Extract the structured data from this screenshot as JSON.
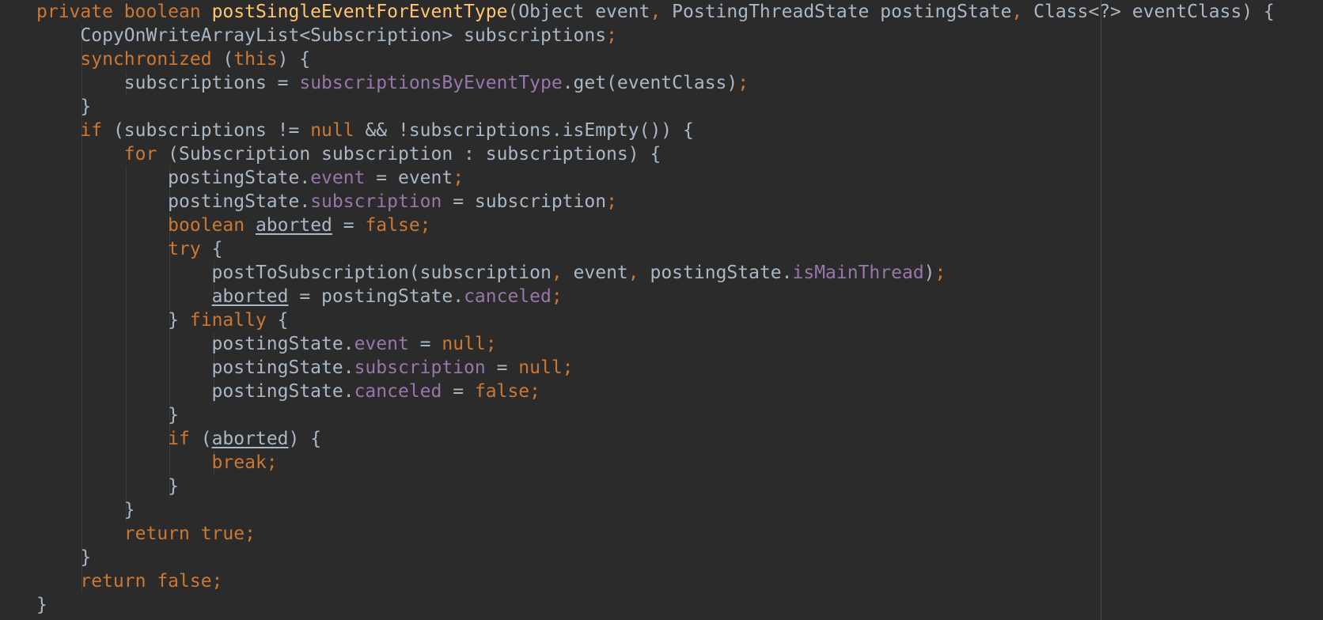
{
  "editor": {
    "theme": "darcula",
    "colors": {
      "background": "#2b2b2b",
      "text": "#a9b7c6",
      "keyword": "#cc7832",
      "function": "#ffc66d",
      "field": "#9876aa"
    },
    "lines": [
      [
        {
          "t": "private boolean ",
          "c": "kw"
        },
        {
          "t": "postSingleEventForEventType",
          "c": "fn"
        },
        {
          "t": "(Object event",
          "c": "pl"
        },
        {
          "t": ", ",
          "c": "kw"
        },
        {
          "t": "PostingThreadState postingState",
          "c": "pl"
        },
        {
          "t": ", ",
          "c": "kw"
        },
        {
          "t": "Class<?> eventClass) {",
          "c": "pl"
        }
      ],
      [
        {
          "t": "    CopyOnWriteArrayList<Subscription> subscriptions",
          "c": "pl"
        },
        {
          "t": ";",
          "c": "kw"
        }
      ],
      [
        {
          "t": "    synchronized ",
          "c": "kw"
        },
        {
          "t": "(",
          "c": "pl"
        },
        {
          "t": "this",
          "c": "kw"
        },
        {
          "t": ") {",
          "c": "pl"
        }
      ],
      [
        {
          "t": "        subscriptions = ",
          "c": "pl"
        },
        {
          "t": "subscriptionsByEventType",
          "c": "fld"
        },
        {
          "t": ".get(eventClass)",
          "c": "pl"
        },
        {
          "t": ";",
          "c": "kw"
        }
      ],
      [
        {
          "t": "    }",
          "c": "pl"
        }
      ],
      [
        {
          "t": "    if ",
          "c": "kw"
        },
        {
          "t": "(subscriptions != ",
          "c": "pl"
        },
        {
          "t": "null ",
          "c": "kw"
        },
        {
          "t": "&& !subscriptions.isEmpty()) {",
          "c": "pl"
        }
      ],
      [
        {
          "t": "        for ",
          "c": "kw"
        },
        {
          "t": "(Subscription subscription : subscriptions) {",
          "c": "pl"
        }
      ],
      [
        {
          "t": "            postingState.",
          "c": "pl"
        },
        {
          "t": "event",
          "c": "fld"
        },
        {
          "t": " = event",
          "c": "pl"
        },
        {
          "t": ";",
          "c": "kw"
        }
      ],
      [
        {
          "t": "            postingState.",
          "c": "pl"
        },
        {
          "t": "subscription",
          "c": "fld"
        },
        {
          "t": " = subscription",
          "c": "pl"
        },
        {
          "t": ";",
          "c": "kw"
        }
      ],
      [
        {
          "t": "            boolean ",
          "c": "kw"
        },
        {
          "t": "aborted",
          "c": "var"
        },
        {
          "t": " = ",
          "c": "pl"
        },
        {
          "t": "false;",
          "c": "kw"
        }
      ],
      [
        {
          "t": "            try ",
          "c": "kw"
        },
        {
          "t": "{",
          "c": "pl"
        }
      ],
      [
        {
          "t": "                postToSubscription(subscription",
          "c": "pl"
        },
        {
          "t": ", ",
          "c": "kw"
        },
        {
          "t": "event",
          "c": "pl"
        },
        {
          "t": ", ",
          "c": "kw"
        },
        {
          "t": "postingState.",
          "c": "pl"
        },
        {
          "t": "isMainThread",
          "c": "fld"
        },
        {
          "t": ")",
          "c": "pl"
        },
        {
          "t": ";",
          "c": "kw"
        }
      ],
      [
        {
          "t": "                ",
          "c": "pl"
        },
        {
          "t": "aborted",
          "c": "var"
        },
        {
          "t": " = postingState.",
          "c": "pl"
        },
        {
          "t": "canceled",
          "c": "fld"
        },
        {
          "t": ";",
          "c": "kw"
        }
      ],
      [
        {
          "t": "            } ",
          "c": "pl"
        },
        {
          "t": "finally ",
          "c": "kw"
        },
        {
          "t": "{",
          "c": "pl"
        }
      ],
      [
        {
          "t": "                postingState.",
          "c": "pl"
        },
        {
          "t": "event",
          "c": "fld"
        },
        {
          "t": " = ",
          "c": "pl"
        },
        {
          "t": "null;",
          "c": "kw"
        }
      ],
      [
        {
          "t": "                postingState.",
          "c": "pl"
        },
        {
          "t": "subscription",
          "c": "fld"
        },
        {
          "t": " = ",
          "c": "pl"
        },
        {
          "t": "null;",
          "c": "kw"
        }
      ],
      [
        {
          "t": "                postingState.",
          "c": "pl"
        },
        {
          "t": "canceled",
          "c": "fld"
        },
        {
          "t": " = ",
          "c": "pl"
        },
        {
          "t": "false;",
          "c": "kw"
        }
      ],
      [
        {
          "t": "            }",
          "c": "pl"
        }
      ],
      [
        {
          "t": "            if ",
          "c": "kw"
        },
        {
          "t": "(",
          "c": "pl"
        },
        {
          "t": "aborted",
          "c": "var"
        },
        {
          "t": ") {",
          "c": "pl"
        }
      ],
      [
        {
          "t": "                break;",
          "c": "kw"
        }
      ],
      [
        {
          "t": "            }",
          "c": "pl"
        }
      ],
      [
        {
          "t": "        }",
          "c": "pl"
        }
      ],
      [
        {
          "t": "        return true;",
          "c": "kw"
        }
      ],
      [
        {
          "t": "    }",
          "c": "pl"
        }
      ],
      [
        {
          "t": "    return false;",
          "c": "kw"
        }
      ],
      [
        {
          "t": "}",
          "c": "pl"
        }
      ]
    ]
  }
}
